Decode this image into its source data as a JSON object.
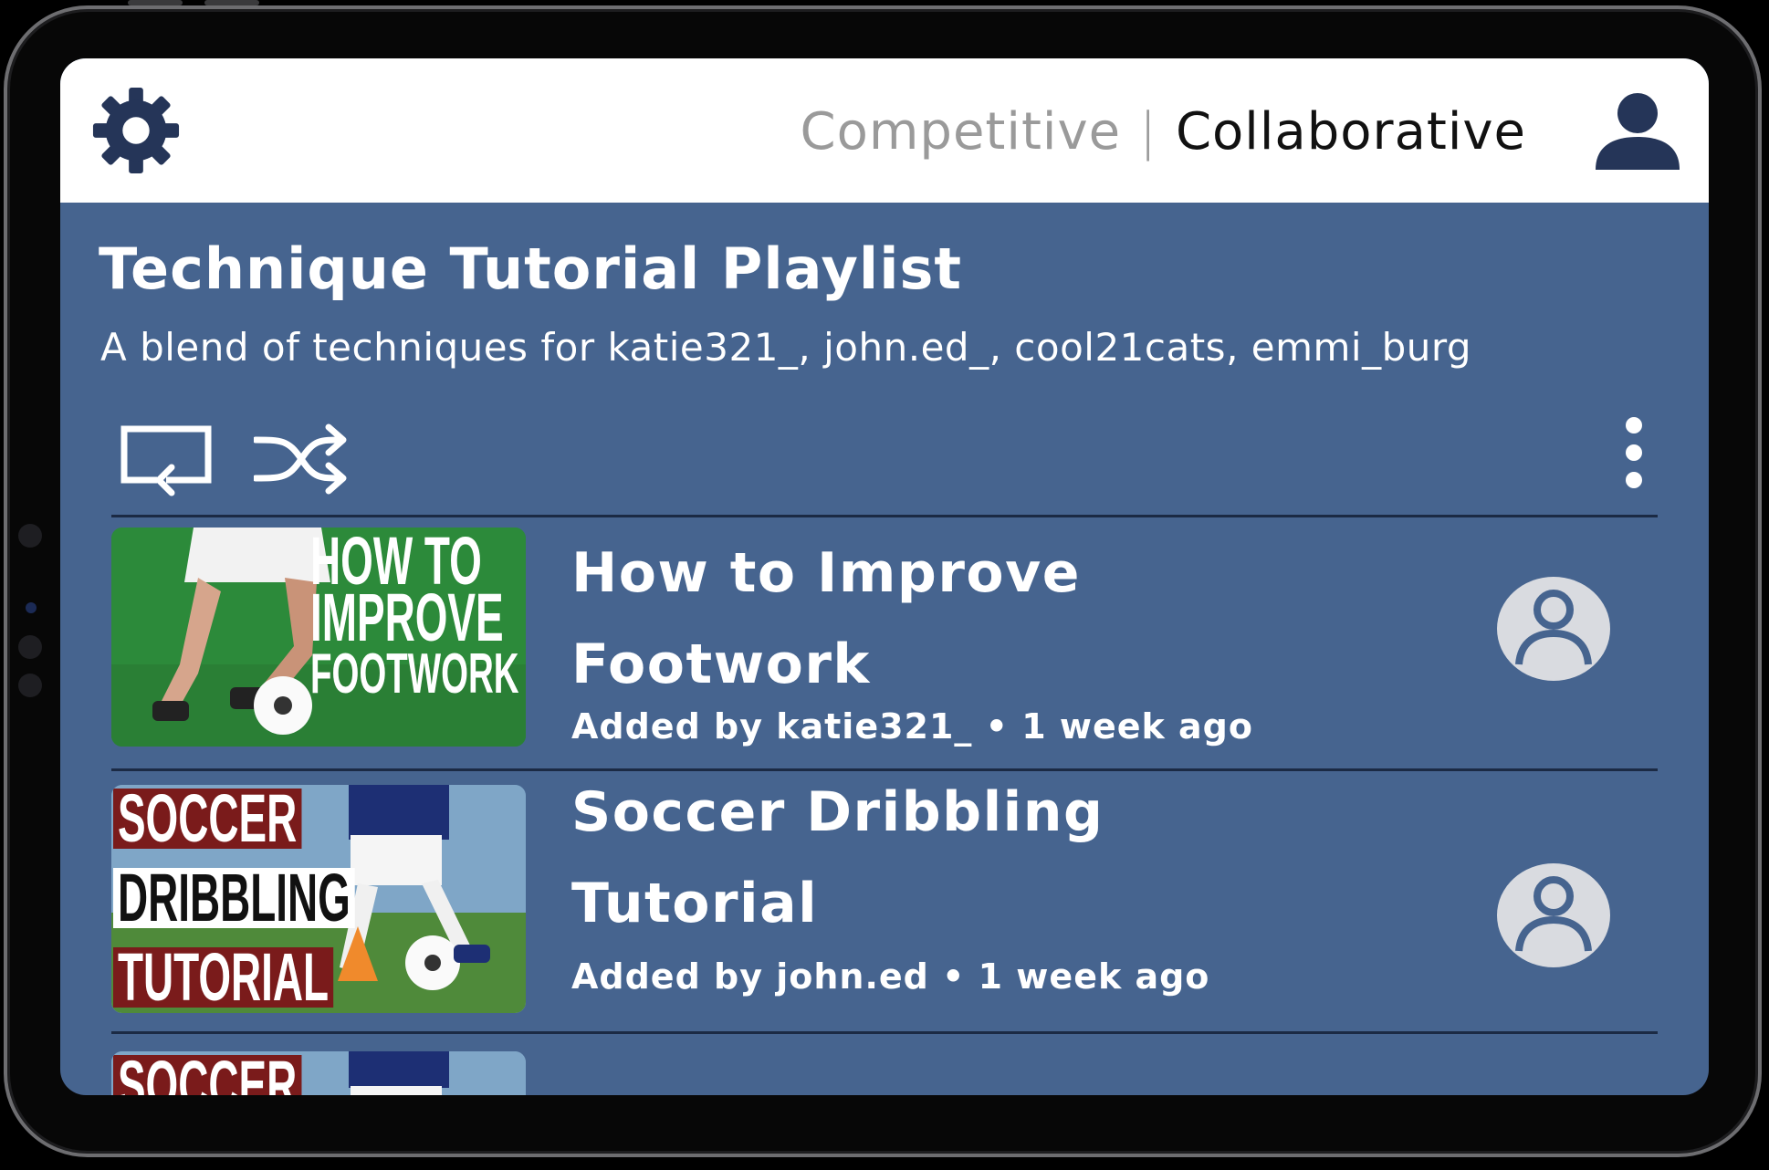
{
  "header": {
    "modes": {
      "inactive": "Competitive",
      "separator": "|",
      "active": "Collaborative"
    },
    "icons": {
      "settings": "gear-icon",
      "profile": "user-icon"
    }
  },
  "playlist": {
    "title": "Technique Tutorial Playlist",
    "description": "A blend of techniques for katie321_, john.ed_, cool21cats, emmi_burg",
    "controls": [
      "repeat-icon",
      "shuffle-icon",
      "more-vertical-icon"
    ],
    "items": [
      {
        "title_line1": "How to Improve",
        "title_line2": "Footwork",
        "added_by": "Added by katie321_",
        "time": "1 week ago",
        "thumbnail_text": [
          "HOW TO",
          "IMPROVE",
          "FOOTWORK"
        ]
      },
      {
        "title_line1": "Soccer Dribbling",
        "title_line2": "Tutorial",
        "added_by": "Added by john.ed",
        "time": "1 week ago",
        "thumbnail_text": [
          "SOCCER",
          "DRIBBLING",
          "TUTORIAL"
        ]
      },
      {
        "thumbnail_text": [
          "SOCCER"
        ]
      }
    ]
  },
  "colors": {
    "background": "#46648f",
    "header": "#ffffff",
    "icon_dark": "#253558",
    "avatar_light": "#d9dbe0"
  }
}
